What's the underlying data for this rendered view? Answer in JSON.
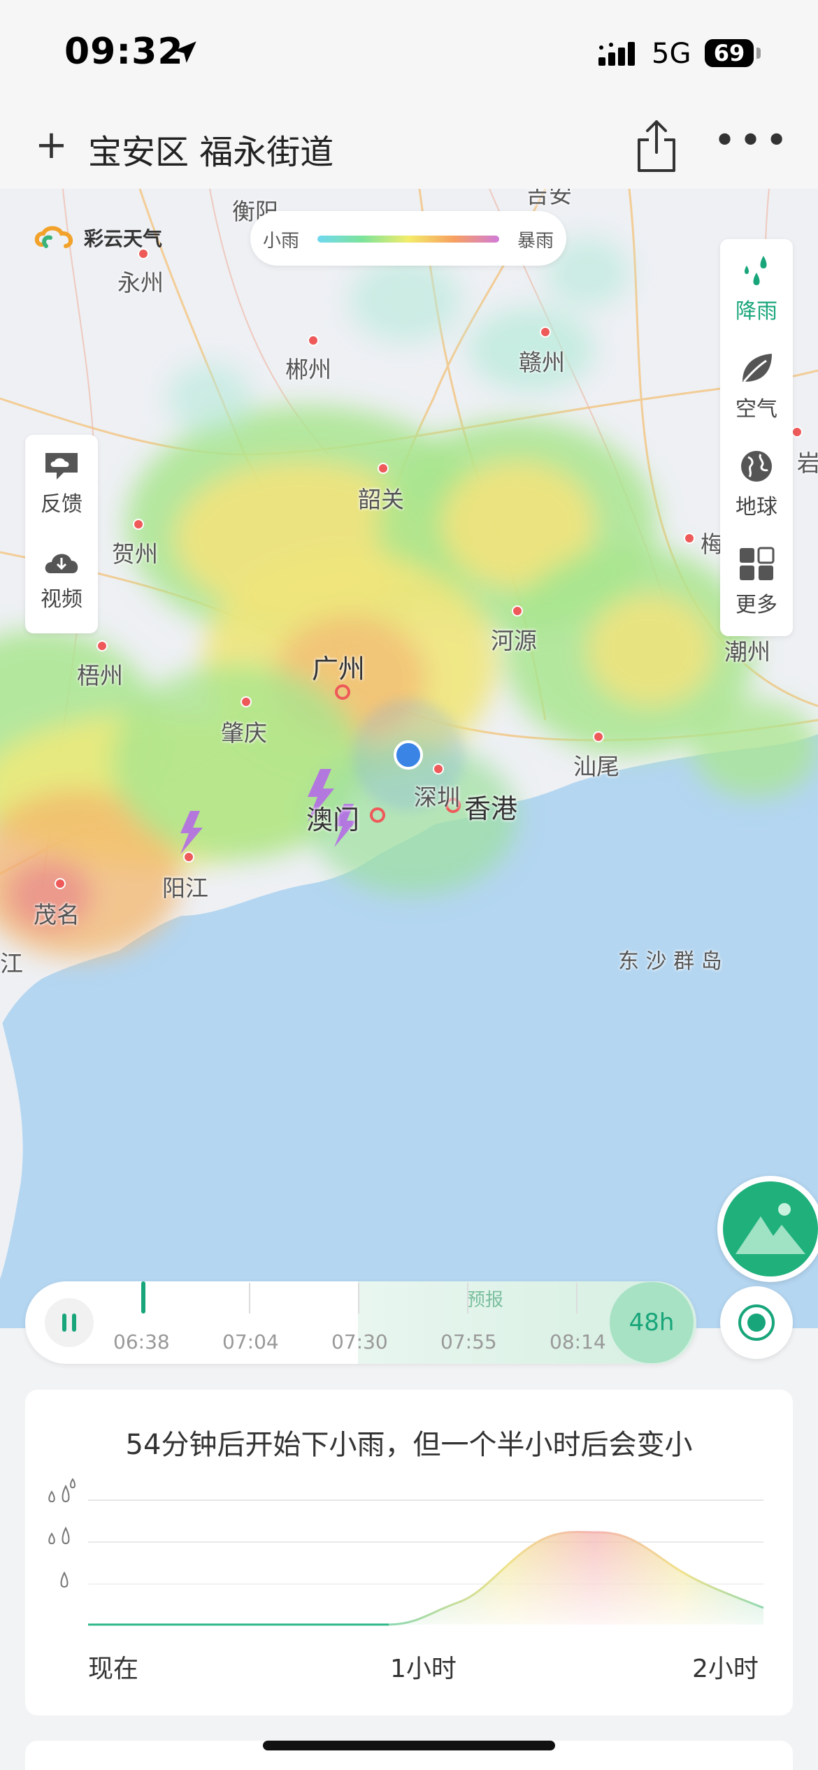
{
  "status_bar": {
    "time": "09:32",
    "network": "5G",
    "battery": "69"
  },
  "nav": {
    "title": "宝安区 福永街道"
  },
  "map": {
    "brand": "彩云天气",
    "legend": {
      "min_label": "小雨",
      "max_label": "暴雨"
    },
    "left_tools": [
      {
        "label": "反馈",
        "icon": "feedback-cloud-icon"
      },
      {
        "label": "视频",
        "icon": "download-cloud-icon"
      }
    ],
    "right_tools": [
      {
        "label": "降雨",
        "icon": "rain-drops-icon",
        "active": true
      },
      {
        "label": "空气",
        "icon": "leaf-icon",
        "active": false
      },
      {
        "label": "地球",
        "icon": "globe-icon",
        "active": false
      },
      {
        "label": "更多",
        "icon": "grid-icon",
        "active": false
      }
    ],
    "cities": [
      {
        "name": "衡阳"
      },
      {
        "name": "永州"
      },
      {
        "name": "郴州"
      },
      {
        "name": "赣州"
      },
      {
        "name": "韶关"
      },
      {
        "name": "贺州"
      },
      {
        "name": "梧州"
      },
      {
        "name": "河源"
      },
      {
        "name": "梅"
      },
      {
        "name": "潮州"
      },
      {
        "name": "广州"
      },
      {
        "name": "肇庆"
      },
      {
        "name": "汕尾"
      },
      {
        "name": "深圳"
      },
      {
        "name": "香港"
      },
      {
        "name": "澳门"
      },
      {
        "name": "阳江"
      },
      {
        "name": "茂名"
      },
      {
        "name": "东 沙 群 岛"
      },
      {
        "name": "岩"
      },
      {
        "name": "江"
      },
      {
        "name": "吉安"
      }
    ],
    "colors": {
      "accent": "#18a57a",
      "sea": "#b4d6f1",
      "land": "#eef0f4",
      "location_dot": "#3a84e6",
      "lightning": "#b46ce6"
    }
  },
  "timeline": {
    "forecast_label": "预报",
    "times": [
      "06:38",
      "07:04",
      "07:30",
      "07:55",
      "08:14"
    ],
    "range_button": "48h"
  },
  "forecast_card": {
    "summary": "54分钟后开始下小雨，但一个半小时后会变小",
    "x_labels": [
      "现在",
      "1小时",
      "2小时"
    ],
    "intensity_levels": [
      "heavy",
      "moderate",
      "light"
    ]
  }
}
